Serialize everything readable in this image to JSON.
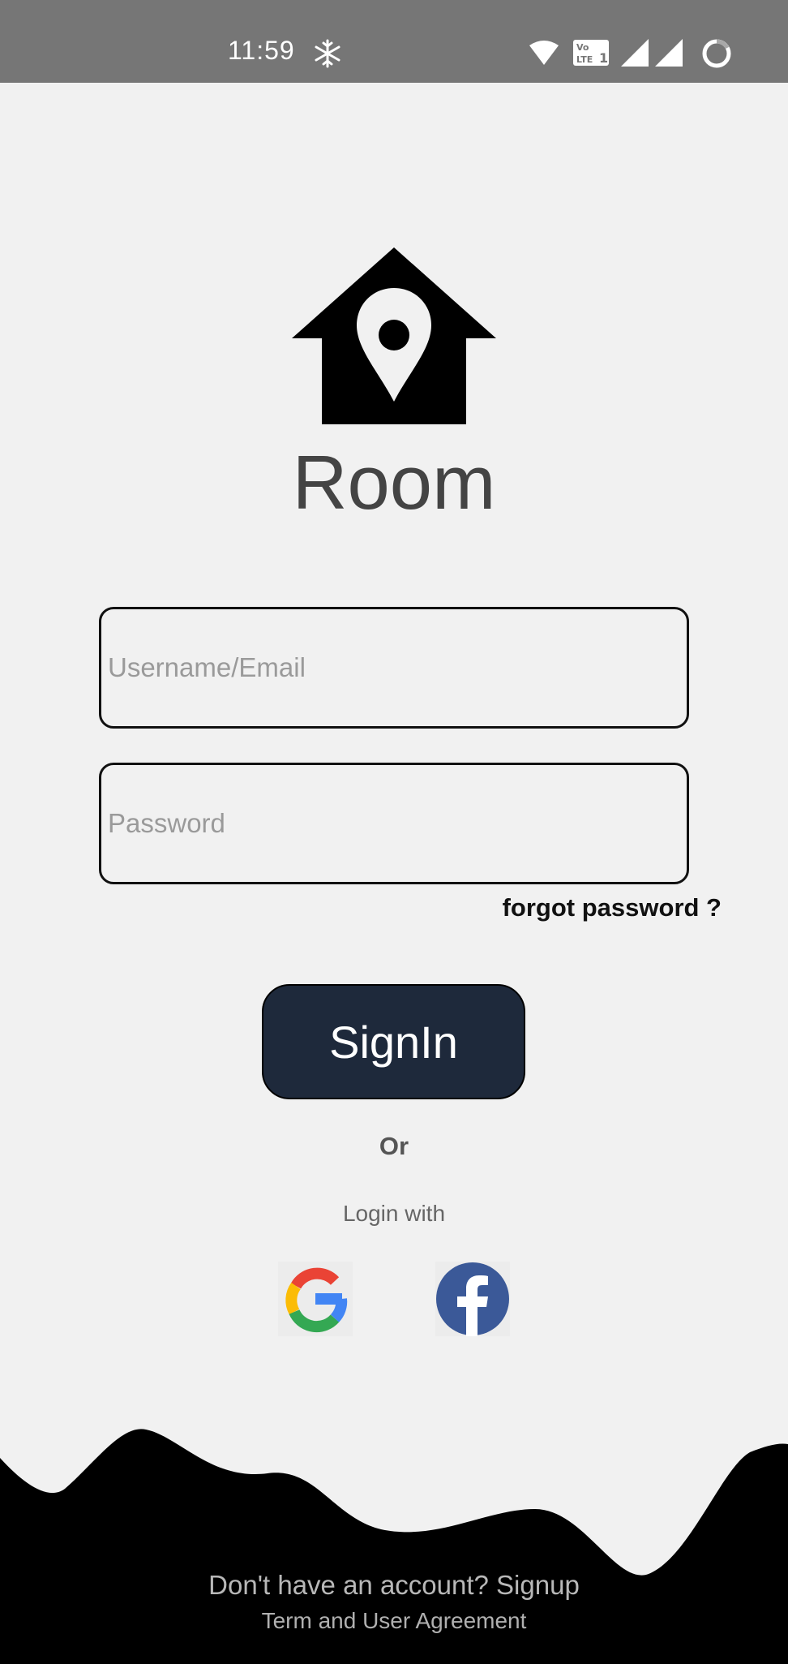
{
  "status_bar": {
    "time": "11:59",
    "icons": [
      "snowflake-icon",
      "wifi-icon",
      "volte-icon",
      "signal-icon",
      "signal-icon",
      "battery-ring-icon"
    ]
  },
  "app": {
    "name": "Room",
    "logo_icon": "house-location-pin-icon"
  },
  "form": {
    "username_placeholder": "Username/Email",
    "username_value": "",
    "password_placeholder": "Password",
    "password_value": "",
    "forgot_label": "forgot password ?",
    "signin_label": "SignIn"
  },
  "alt_login": {
    "or_label": "Or",
    "login_with_label": "Login with",
    "providers": [
      {
        "name": "google",
        "icon": "google-icon"
      },
      {
        "name": "facebook",
        "icon": "facebook-icon"
      }
    ]
  },
  "footer": {
    "signup_text": "Don't have an account? Signup",
    "terms_text": "Term and User Agreement"
  },
  "colors": {
    "status_bar": "#767676",
    "background": "#f1f1f1",
    "button": "#1e293b",
    "facebook": "#3b5998",
    "wave": "#000000"
  }
}
